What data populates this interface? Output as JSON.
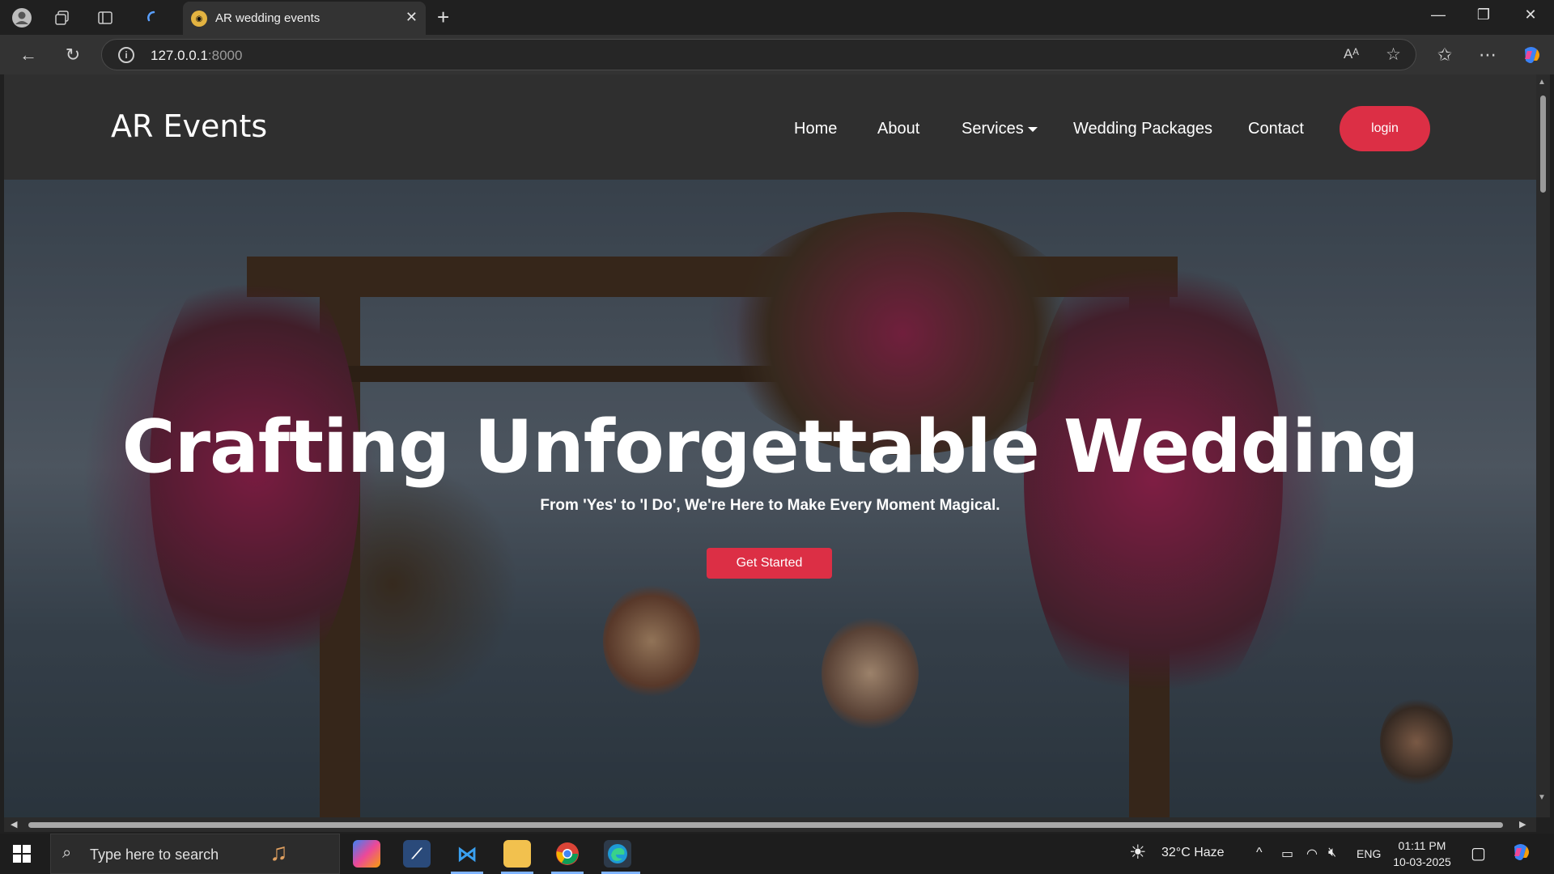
{
  "browser": {
    "tab_title": "AR wedding events",
    "url_host": "127.0.0.1",
    "url_port": ":8000"
  },
  "site": {
    "brand": "AR Events",
    "nav": {
      "home": "Home",
      "about": "About",
      "services": "Services",
      "packages": "Wedding Packages",
      "contact": "Contact",
      "login": "login"
    },
    "hero": {
      "title": "Crafting Unforgettable Wedding",
      "subtitle": "From 'Yes' to 'I Do', We're Here to Make Every Moment Magical.",
      "cta": "Get Started"
    },
    "colors": {
      "accent": "#dc2f45",
      "nav_bg": "#2f2f2f"
    }
  },
  "taskbar": {
    "search_placeholder": "Type here to search",
    "weather": "32°C  Haze",
    "language": "ENG",
    "time": "01:11 PM",
    "date": "10-03-2025"
  }
}
